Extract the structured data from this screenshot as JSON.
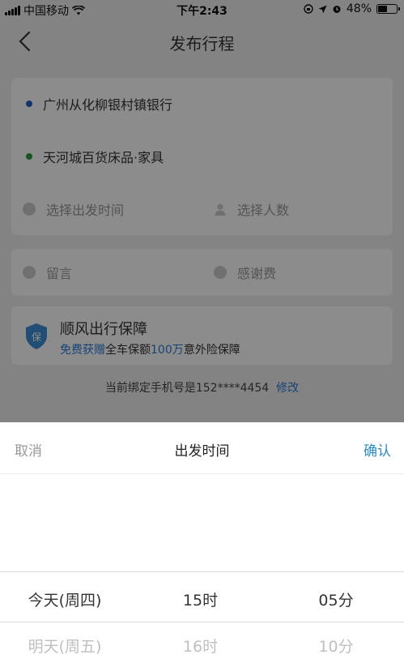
{
  "status_bar": {
    "carrier": "中国移动",
    "time": "下午2:43",
    "battery": "48%"
  },
  "nav": {
    "title": "发布行程"
  },
  "route": {
    "start": "广州从化柳银村镇银行",
    "end": "天河城百货床品·家具",
    "time_placeholder": "选择出发时间",
    "people_placeholder": "选择人数"
  },
  "extra": {
    "message_placeholder": "留言",
    "thanks_placeholder": "感谢费"
  },
  "insurance": {
    "title": "顺风出行保障",
    "desc_prefix": "免费获赠",
    "desc_mid": "全车保额",
    "amount": "100万",
    "desc_suffix": "意外险保障"
  },
  "phone": {
    "label": "当前绑定手机号是152****4454",
    "edit": "修改"
  },
  "picker": {
    "cancel": "取消",
    "title": "出发时间",
    "confirm": "确认",
    "day": [
      "今天(周四)",
      "明天(周五)"
    ],
    "hour": [
      "15时",
      "16时"
    ],
    "minute": [
      "05分",
      "10分"
    ]
  },
  "colors": {
    "start_dot": "#1f5fbf",
    "end_dot": "#2a9a3c",
    "accent": "#2a8bc8"
  }
}
